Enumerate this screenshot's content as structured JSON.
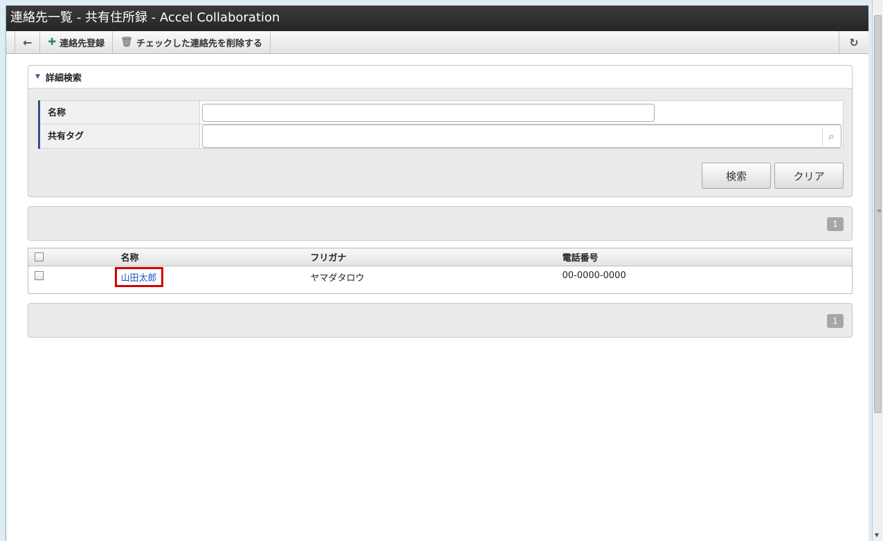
{
  "window": {
    "title": "連絡先一覧 - 共有住所録 - Accel Collaboration"
  },
  "toolbar": {
    "back_icon": "arrow-left-icon",
    "register_label": "連絡先登録",
    "delete_label": "チェックした連絡先を削除する",
    "refresh_icon": "refresh-icon"
  },
  "search": {
    "header": "詳細検索",
    "name_label": "名称",
    "name_value": "",
    "tag_label": "共有タグ",
    "tag_value": "",
    "search_button": "検索",
    "clear_button": "クリア"
  },
  "pager": {
    "page": "1"
  },
  "results": {
    "columns": [
      "名称",
      "フリガナ",
      "電話番号"
    ],
    "rows": [
      {
        "name": "山田太郎",
        "kana": "ヤマダタロウ",
        "phone": "00-0000-0000"
      }
    ]
  },
  "colors": {
    "highlight": "#d10000",
    "link": "#1a4fc4",
    "titlebar": "#262626"
  }
}
